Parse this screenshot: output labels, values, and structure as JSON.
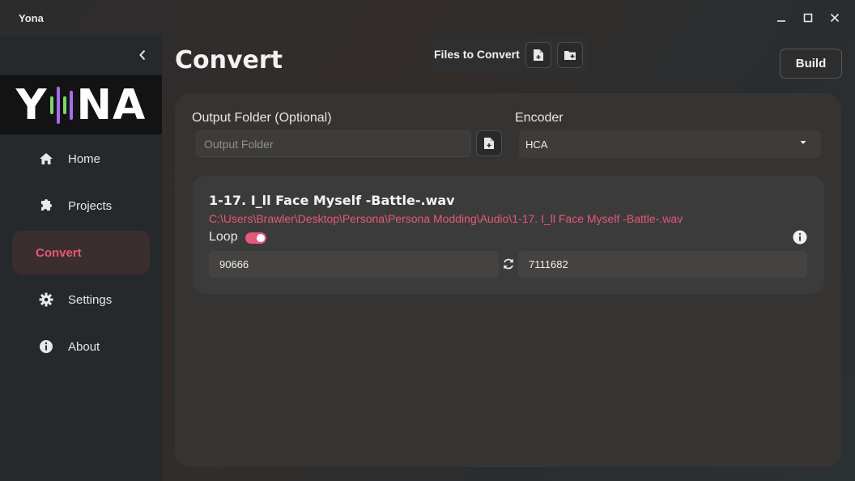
{
  "window": {
    "title": "Yona"
  },
  "sidebar": {
    "logo_text_left": "Y",
    "logo_text_right": "NA",
    "items": [
      {
        "label": "Home",
        "icon": "home-icon"
      },
      {
        "label": "Projects",
        "icon": "puzzle-icon"
      },
      {
        "label": "Convert",
        "icon": "",
        "active": true
      },
      {
        "label": "Settings",
        "icon": "gear-icon"
      },
      {
        "label": "About",
        "icon": "info-icon"
      }
    ]
  },
  "header": {
    "page_title": "Convert",
    "files_label": "Files to Convert",
    "build_label": "Build"
  },
  "output": {
    "label": "Output Folder (Optional)",
    "placeholder": "Output Folder"
  },
  "encoder": {
    "label": "Encoder",
    "selected": "HCA"
  },
  "file_card": {
    "name": "1-17. I_ll Face Myself -Battle-.wav",
    "path": "C:\\Users\\Brawler\\Desktop\\Persona\\Persona Modding\\Audio\\1-17. I_ll Face Myself -Battle-.wav",
    "loop_label": "Loop",
    "loop_enabled": true,
    "loop_start": "90666",
    "loop_end": "7111682"
  },
  "colors": {
    "accent": "#e5597a",
    "logo_wave_green": "#7ad86a",
    "logo_wave_purple": "#a66cf0"
  }
}
